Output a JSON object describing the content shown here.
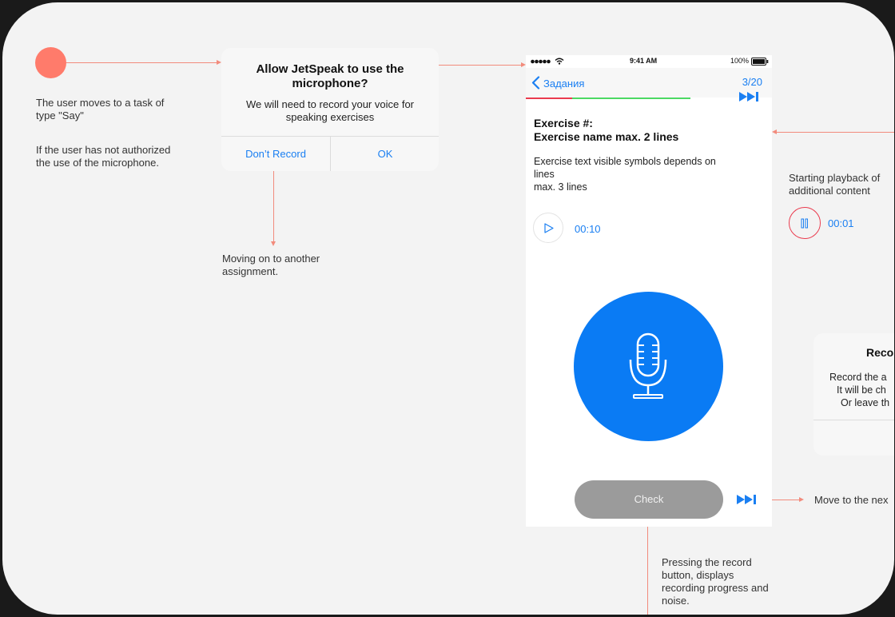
{
  "notes": {
    "start_line1": "The user moves to a task of",
    "start_line2": "type \"Say\"",
    "auth_line1": "If the user has not authorized",
    "auth_line2": "the use of the microphone.",
    "moving_line1": "Moving on to another",
    "moving_line2": "assignment.",
    "playback_line1": "Starting playback of",
    "playback_line2": "additional content",
    "move_next": "Move to the nex",
    "record_line1": "Pressing the record",
    "record_line2": "button, displays",
    "record_line3": "recording progress and",
    "record_line4": "noise."
  },
  "alert": {
    "title_line1": "Allow JetSpeak to use the",
    "title_line2": "microphone?",
    "message_line1": "We will need to record your voice for",
    "message_line2": "speaking exercises",
    "dont_record": "Don’t Record",
    "ok": "OK"
  },
  "phone": {
    "status": {
      "time": "9:41 AM",
      "battery": "100%"
    },
    "nav": {
      "back": "Задания",
      "counter": "3/20"
    },
    "progress": {
      "completed_fraction": 0.19,
      "current_fraction": 0.48
    },
    "exercise": {
      "title_line1": "Exercise #:",
      "title_line2": "Exercise name max. 2 lines",
      "text_line1": "Exercise text visible symbols depends on",
      "text_line2": "lines",
      "text_line3": "max. 3 lines"
    },
    "player": {
      "time": "00:10"
    },
    "check": "Check"
  },
  "playback": {
    "time": "00:01"
  },
  "dialog2": {
    "title": "Reco",
    "line1": "Record the a",
    "line2": "It will be ch",
    "line3": "Or leave th"
  },
  "colors": {
    "accent": "#1a7ff2",
    "mic": "#0a7bf4",
    "connector": "#f28b7c",
    "start_dot": "#ff7b6b",
    "progress_red": "#ea3b4e",
    "progress_green": "#4cd964"
  },
  "icons": [
    "microphone-icon",
    "play-icon",
    "pause-icon",
    "skip-forward-icon",
    "chevron-left-icon",
    "wifi-icon",
    "battery-icon",
    "signal-dots-icon"
  ]
}
